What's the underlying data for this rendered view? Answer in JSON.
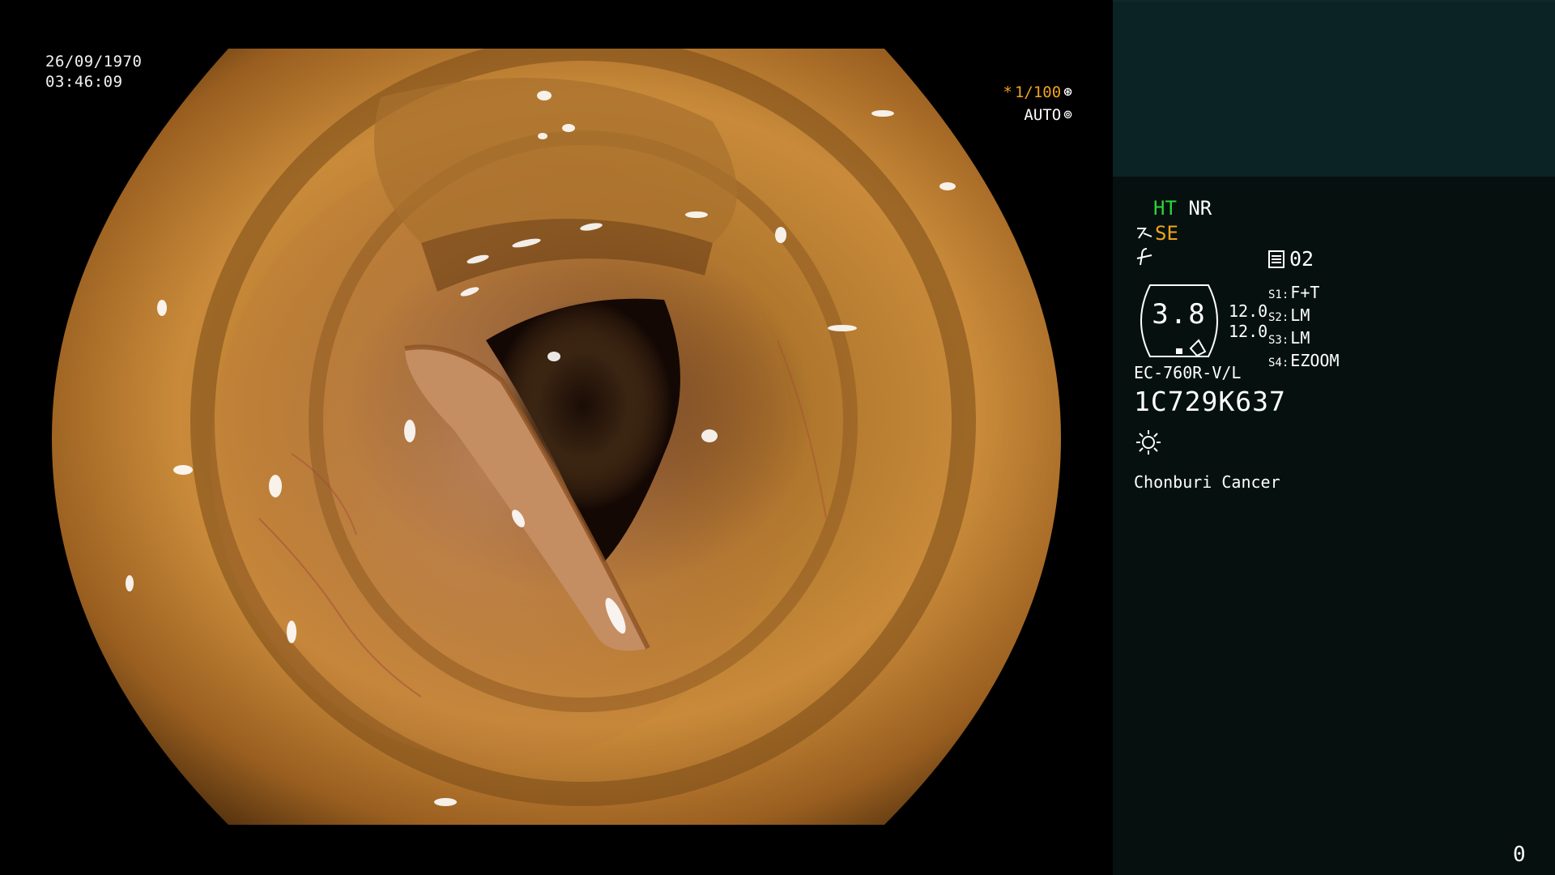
{
  "overlay": {
    "date": "26/09/1970",
    "time": "03:46:09",
    "shutter_star": "*",
    "shutter_speed": "1/100",
    "shutter_icon": "aperture-icon",
    "exposure_mode": "AUTO",
    "exposure_icon": "iris-icon"
  },
  "panel": {
    "ht": "HT",
    "nr": "NR",
    "se_icon": "scope-hook-icon",
    "se": "SE",
    "f_icon": "f-symbol-icon",
    "memory_icon": "memory-card-icon",
    "memory_value": "02",
    "gauge_value": "3.8",
    "gauge_line1": "12.0",
    "gauge_line2": "12.0",
    "settings": [
      {
        "label": "S1:",
        "value": "F+T"
      },
      {
        "label": "S2:",
        "value": "LM"
      },
      {
        "label": "S3:",
        "value": "LM"
      },
      {
        "label": "S4:",
        "value": "EZOOM"
      }
    ],
    "model": "EC-760R-V/L",
    "serial": "1C729K637",
    "light_icon": "sun-icon",
    "hospital": "Chonburi Cancer",
    "counter": "0"
  },
  "colors": {
    "panel_bg": "#06110f",
    "panel_top_bg": "#0c2326",
    "accent_orange": "#f0a21e",
    "accent_green": "#2ed33b"
  }
}
